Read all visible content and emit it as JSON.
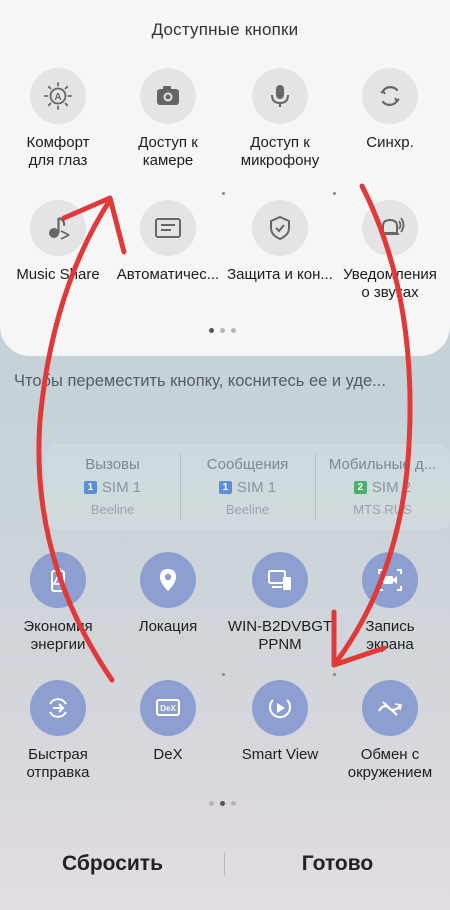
{
  "available": {
    "title": "Доступные кнопки",
    "row1": [
      {
        "label": "Комфорт\nдля глаз",
        "icon": "eye-comfort-icon"
      },
      {
        "label": "Доступ к\nкамере",
        "icon": "camera-icon"
      },
      {
        "label": "Доступ к\nмикрофону",
        "icon": "microphone-icon"
      },
      {
        "label": "Синхр.",
        "icon": "sync-icon"
      }
    ],
    "row2": [
      {
        "label": "Music Share",
        "icon": "music-share-icon"
      },
      {
        "label": "Автоматичес...",
        "icon": "auto-text-icon"
      },
      {
        "label": "Защита и кон...",
        "icon": "shield-check-icon"
      },
      {
        "label": "Уведомления\nо звуках",
        "icon": "sound-notification-icon"
      }
    ]
  },
  "hint": "Чтобы переместить кнопку, коснитесь ее и уде...",
  "sim": [
    {
      "title": "Вызовы",
      "badge": "1",
      "sim": "SIM 1",
      "carrier": "Beeline",
      "badge_color": "#5b8fd6"
    },
    {
      "title": "Сообщения",
      "badge": "1",
      "sim": "SIM 1",
      "carrier": "Beeline",
      "badge_color": "#5b8fd6"
    },
    {
      "title": "Мобильные д...",
      "badge": "2",
      "sim": "SIM 2",
      "carrier": "MTS RUS",
      "badge_color": "#4caf6e"
    }
  ],
  "active": {
    "row1": [
      {
        "label": "Экономия\nэнергии",
        "icon": "power-saving-icon"
      },
      {
        "label": "Локация",
        "icon": "location-icon"
      },
      {
        "label": "WIN-B2DVBGT\nPPNM",
        "icon": "device-link-icon"
      },
      {
        "label": "Запись\nэкрана",
        "icon": "screen-record-icon"
      }
    ],
    "row2": [
      {
        "label": "Быстрая\nотправка",
        "icon": "quick-share-icon"
      },
      {
        "label": "DeX",
        "icon": "dex-icon"
      },
      {
        "label": "Smart View",
        "icon": "smart-view-icon"
      },
      {
        "label": "Обмен с\nокружением",
        "icon": "nearby-share-icon"
      }
    ]
  },
  "footer": {
    "reset": "Сбросить",
    "done": "Готово"
  },
  "colors": {
    "arrow": "#e0393a",
    "active_icon_bg": "#8c9fd0",
    "panel_bg": "#f6f6f7"
  },
  "dex_text": "DeX"
}
